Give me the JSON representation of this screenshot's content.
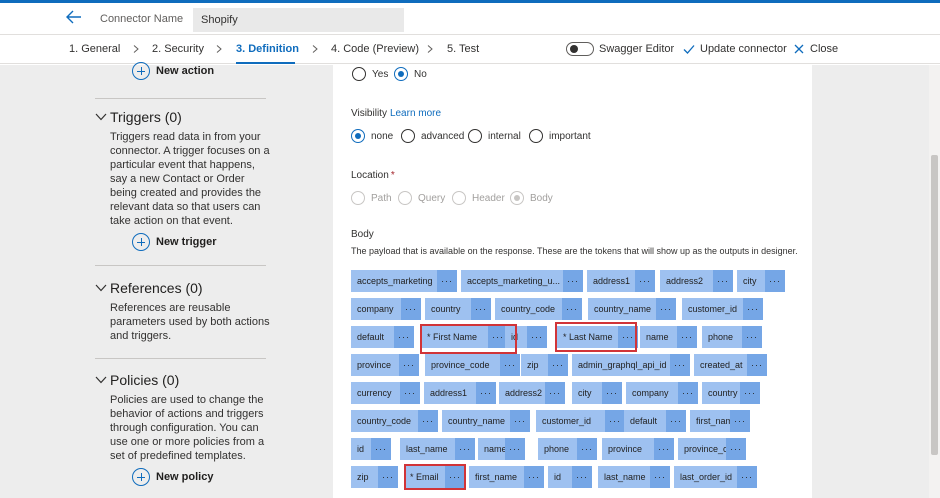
{
  "header": {
    "connector_label": "Connector Name",
    "connector_value": "Shopify"
  },
  "tabs": [
    {
      "label": "1. General"
    },
    {
      "label": "2. Security"
    },
    {
      "label": "3. Definition"
    },
    {
      "label": "4. Code (Preview)"
    },
    {
      "label": "5. Test"
    }
  ],
  "toolbar": {
    "swagger_label": "Swagger Editor",
    "swagger_on": false,
    "update_label": "Update connector",
    "close_label": "Close"
  },
  "sidebar": {
    "new_action": "New action",
    "triggers": {
      "title": "Triggers (0)",
      "desc": "Triggers read data in from your connector. A trigger focuses on a particular event that happens, say a new Contact or Order being created and provides the relevant data so that users can take action on that event.",
      "button": "New trigger"
    },
    "references": {
      "title": "References (0)",
      "desc": "References are reusable parameters used by both actions and triggers."
    },
    "policies": {
      "title": "Policies (0)",
      "desc": "Policies are used to change the behavior of actions and triggers through configuration. You can use one or more policies from a set of predefined templates.",
      "button": "New policy"
    }
  },
  "form": {
    "yes_no": {
      "options": [
        "Yes",
        "No"
      ],
      "selected": "No"
    },
    "visibility": {
      "label": "Visibility",
      "learn_more": "Learn more",
      "options": [
        "none",
        "advanced",
        "internal",
        "important"
      ],
      "selected": "none"
    },
    "location": {
      "label": "Location",
      "required_mark": "*",
      "options": [
        "Path",
        "Query",
        "Header",
        "Body"
      ],
      "selected": "Body"
    },
    "body": {
      "label": "Body",
      "desc": "The payload that is available on the response. These are the tokens that will show up as the outputs in designer.",
      "dots": "···",
      "rows": [
        [
          "accepts_marketing",
          "accepts_marketing_u...",
          "address1",
          "address2",
          "city"
        ],
        [
          "company",
          "country",
          "country_code",
          "country_name",
          "customer_id"
        ],
        [
          "default",
          "* First Name",
          "id",
          "* Last Name",
          "name",
          "phone"
        ],
        [
          "province",
          "province_code",
          "zip",
          "admin_graphql_api_id",
          "created_at"
        ],
        [
          "currency",
          "address1",
          "address2",
          "city",
          "company",
          "country"
        ],
        [
          "country_code",
          "country_name",
          "customer_id",
          "default",
          "first_name"
        ],
        [
          "id",
          "last_name",
          "name",
          "phone",
          "province",
          "province_code"
        ],
        [
          "zip",
          "* Email",
          "first_name",
          "id",
          "last_name",
          "last_order_id"
        ]
      ]
    }
  }
}
